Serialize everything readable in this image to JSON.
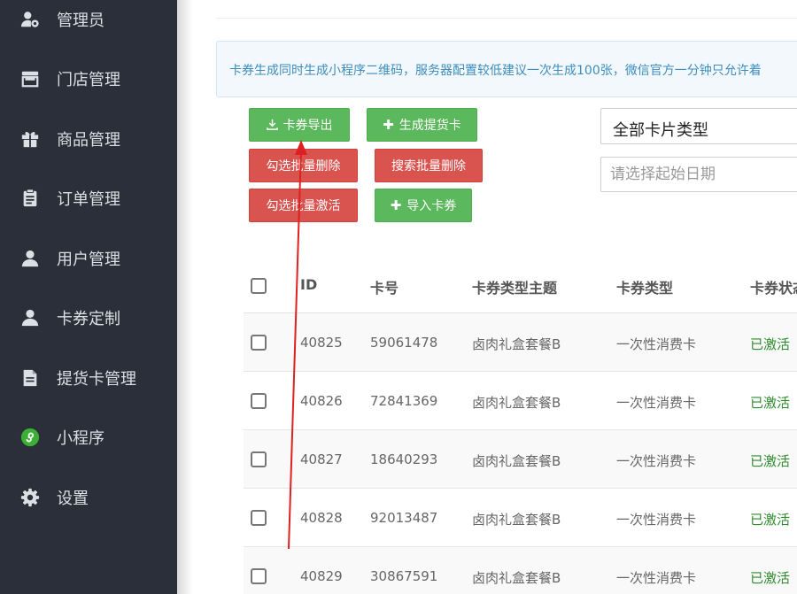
{
  "sidebar": {
    "items": [
      {
        "label": "管理员",
        "icon": "user-gear-icon"
      },
      {
        "label": "门店管理",
        "icon": "store-icon"
      },
      {
        "label": "商品管理",
        "icon": "gift-icon"
      },
      {
        "label": "订单管理",
        "icon": "clipboard-icon"
      },
      {
        "label": "用户管理",
        "icon": "user-icon"
      },
      {
        "label": "卡券定制",
        "icon": "user-icon"
      },
      {
        "label": "提货卡管理",
        "icon": "file-icon"
      },
      {
        "label": "小程序",
        "icon": "miniprogram-icon"
      },
      {
        "label": "设置",
        "icon": "gear-icon"
      }
    ]
  },
  "notice": {
    "text": "卡券生成同时生成小程序二维码，服务器配置较低建议一次生成100张，微信官方一分钟只允许着"
  },
  "toolbar": {
    "export_label": "卡券导出",
    "generate_label": "生成提货卡",
    "batch_delete_checked_label": "勾选批量删除",
    "batch_delete_search_label": "搜索批量删除",
    "batch_activate_checked_label": "勾选批量激活",
    "import_label": "导入卡券",
    "colors": {
      "green": "#5cb85c",
      "red": "#d9534f"
    }
  },
  "filters": {
    "card_type_selected": "全部卡片类型",
    "start_date_placeholder": "请选择起始日期"
  },
  "table": {
    "headers": {
      "id": "ID",
      "number": "卡号",
      "theme": "卡券类型主题",
      "type": "卡券类型",
      "status": "卡券状态"
    },
    "rows": [
      {
        "id": "40825",
        "number": "59061478",
        "theme": "卤肉礼盒套餐B",
        "type": "一次性消费卡",
        "status": "已激活"
      },
      {
        "id": "40826",
        "number": "72841369",
        "theme": "卤肉礼盒套餐B",
        "type": "一次性消费卡",
        "status": "已激活"
      },
      {
        "id": "40827",
        "number": "18640293",
        "theme": "卤肉礼盒套餐B",
        "type": "一次性消费卡",
        "status": "已激活"
      },
      {
        "id": "40828",
        "number": "92013487",
        "theme": "卤肉礼盒套餐B",
        "type": "一次性消费卡",
        "status": "已激活"
      },
      {
        "id": "40829",
        "number": "30867591",
        "theme": "卤肉礼盒套餐B",
        "type": "一次性消费卡",
        "status": "已激活"
      }
    ]
  },
  "colors": {
    "sidebar_bg": "#2b2f3a",
    "status_active": "#2e8b2e",
    "arrow": "#e02020"
  }
}
